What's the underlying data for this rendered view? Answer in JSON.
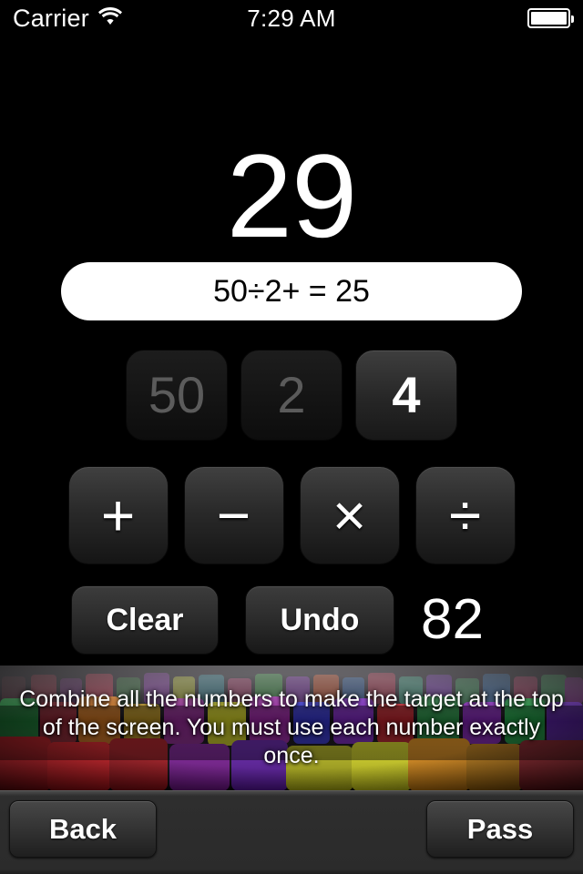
{
  "status_bar": {
    "carrier": "Carrier",
    "wifi_icon": "wifi-icon",
    "time": "7:29 AM",
    "battery_icon": "battery-full-icon"
  },
  "game": {
    "target": "29",
    "expression": "50÷2+ = 25",
    "score": "82",
    "tiles": [
      {
        "label": "50",
        "state": "used"
      },
      {
        "label": "2",
        "state": "used"
      },
      {
        "label": "4",
        "state": "active"
      }
    ],
    "operators": [
      {
        "name": "plus",
        "glyph": "+"
      },
      {
        "name": "minus",
        "glyph": "−"
      },
      {
        "name": "multiply",
        "glyph": "×"
      },
      {
        "name": "divide",
        "glyph": "÷"
      }
    ],
    "clear_label": "Clear",
    "undo_label": "Undo"
  },
  "banner": {
    "instructions": "Combine all the numbers to make the target at the top of the screen. You must use each number exactly once."
  },
  "toolbar": {
    "back_label": "Back",
    "pass_label": "Pass"
  },
  "colors": {
    "background": "#000000",
    "expression_bg": "#ffffff",
    "expression_text": "#000000",
    "tile_active_text": "#ffffff",
    "tile_used_text": "#5b5b5b",
    "toolbar_bg": "#2b2b2b"
  }
}
